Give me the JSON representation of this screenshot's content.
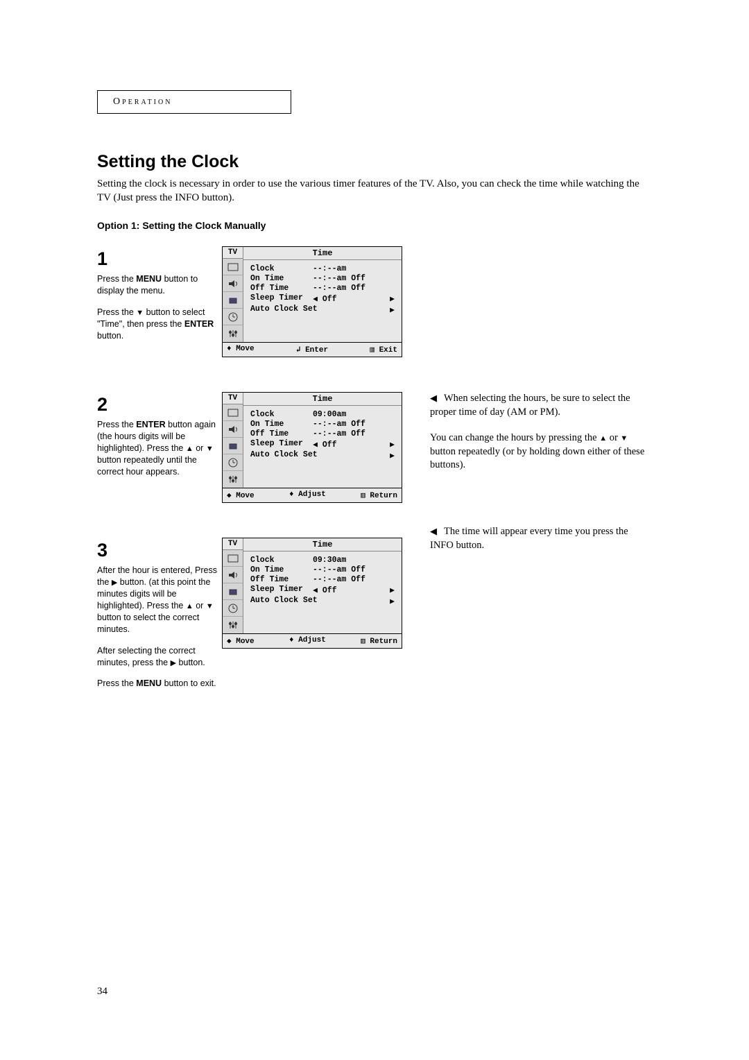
{
  "section": "Operation",
  "heading": "Setting the Clock",
  "intro": "Setting the clock is necessary in order to use the various timer features of the TV. Also, you can check the time while watching the TV (Just press the INFO button).",
  "option_heading": "Option 1: Setting the Clock Manually",
  "steps": {
    "s1": {
      "num": "1",
      "para1_a": "Press the ",
      "para1_menu": "MENU",
      "para1_b": " button to display the menu.",
      "para2_a": "Press the ",
      "para2_b": " button to select \"Time\", then press the ",
      "para2_enter": "ENTER",
      "para2_c": " button."
    },
    "s2": {
      "num": "2",
      "para1_a": "Press the ",
      "para1_enter": "ENTER",
      "para1_b": " button again (the hours digits will be highlighted). Press the ",
      "para1_c": " or ",
      "para1_d": " button repeatedly until the correct hour appears.",
      "note1": "When selecting the hours, be sure to select the proper time of day (AM or PM).",
      "note2a": "You can change the hours by pressing the ",
      "note2b": " or ",
      "note2c": " button repeatedly (or by holding down either of these buttons)."
    },
    "s3": {
      "num": "3",
      "para1_a": "After the hour is entered, Press the ",
      "para1_b": " button. (at this point the minutes digits will be highlighted). Press the ",
      "para1_c": " or ",
      "para1_d": " button to select the correct minutes.",
      "para2_a": "After selecting the correct minutes, press the ",
      "para2_b": " button.",
      "para3_a": "Press the ",
      "para3_menu": "MENU",
      "para3_b": " button to exit.",
      "note1": "The time will appear every time you press the INFO button."
    }
  },
  "osd": {
    "tv": "TV",
    "title": "Time",
    "labels": {
      "clock": "Clock",
      "ontime": "On Time",
      "offtime": "Off Time",
      "sleep": "Sleep Timer",
      "autoset": "Auto Clock Set"
    },
    "values1": {
      "clock": "--:--am",
      "ontime": "--:--am Off",
      "offtime": "--:--am Off",
      "sleep": "◀ Off"
    },
    "values2": {
      "clock": "09:00am",
      "ontime": "--:--am Off",
      "offtime": "--:--am Off",
      "sleep": "◀ Off"
    },
    "values3": {
      "clock": "09:30am",
      "ontime": "--:--am Off",
      "offtime": "--:--am Off",
      "sleep": "◀ Off"
    },
    "footer1": {
      "left": "♦ Move",
      "mid": "↲ Enter",
      "right": "▥ Exit"
    },
    "footer2": {
      "left": "◆ Move",
      "mid": "♦ Adjust",
      "right": "▥ Return"
    }
  },
  "page_number": "34"
}
